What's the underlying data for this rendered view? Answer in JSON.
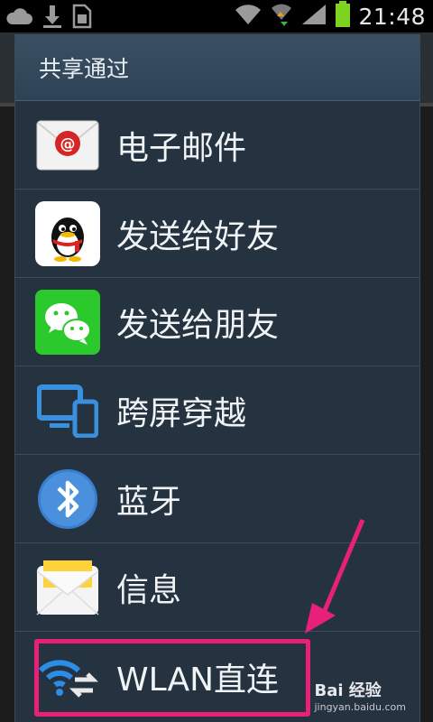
{
  "status_bar": {
    "time": "21:48",
    "left_icons": [
      "cloud-icon",
      "download-icon",
      "sim-icon"
    ],
    "right_icons": [
      "wifi-icon",
      "data-arrows-icon",
      "signal-icon",
      "battery-icon"
    ]
  },
  "dialog": {
    "title": "共享通过",
    "items": [
      {
        "label": "电子邮件",
        "icon": "email-icon"
      },
      {
        "label": "发送给好友",
        "icon": "qq-icon"
      },
      {
        "label": "发送给朋友",
        "icon": "wechat-icon"
      },
      {
        "label": "跨屏穿越",
        "icon": "multiscreen-icon"
      },
      {
        "label": "蓝牙",
        "icon": "bluetooth-icon"
      },
      {
        "label": "信息",
        "icon": "message-icon"
      },
      {
        "label": "WLAN直连",
        "icon": "wifi-direct-icon"
      }
    ]
  },
  "watermark": {
    "main": "Bai 经验",
    "sub": "jingyan.baidu.com"
  },
  "colors": {
    "dialog_bg": "#253340",
    "highlight": "#e8207a",
    "accent_green": "#2bc92b",
    "accent_blue": "#3a8fde"
  }
}
